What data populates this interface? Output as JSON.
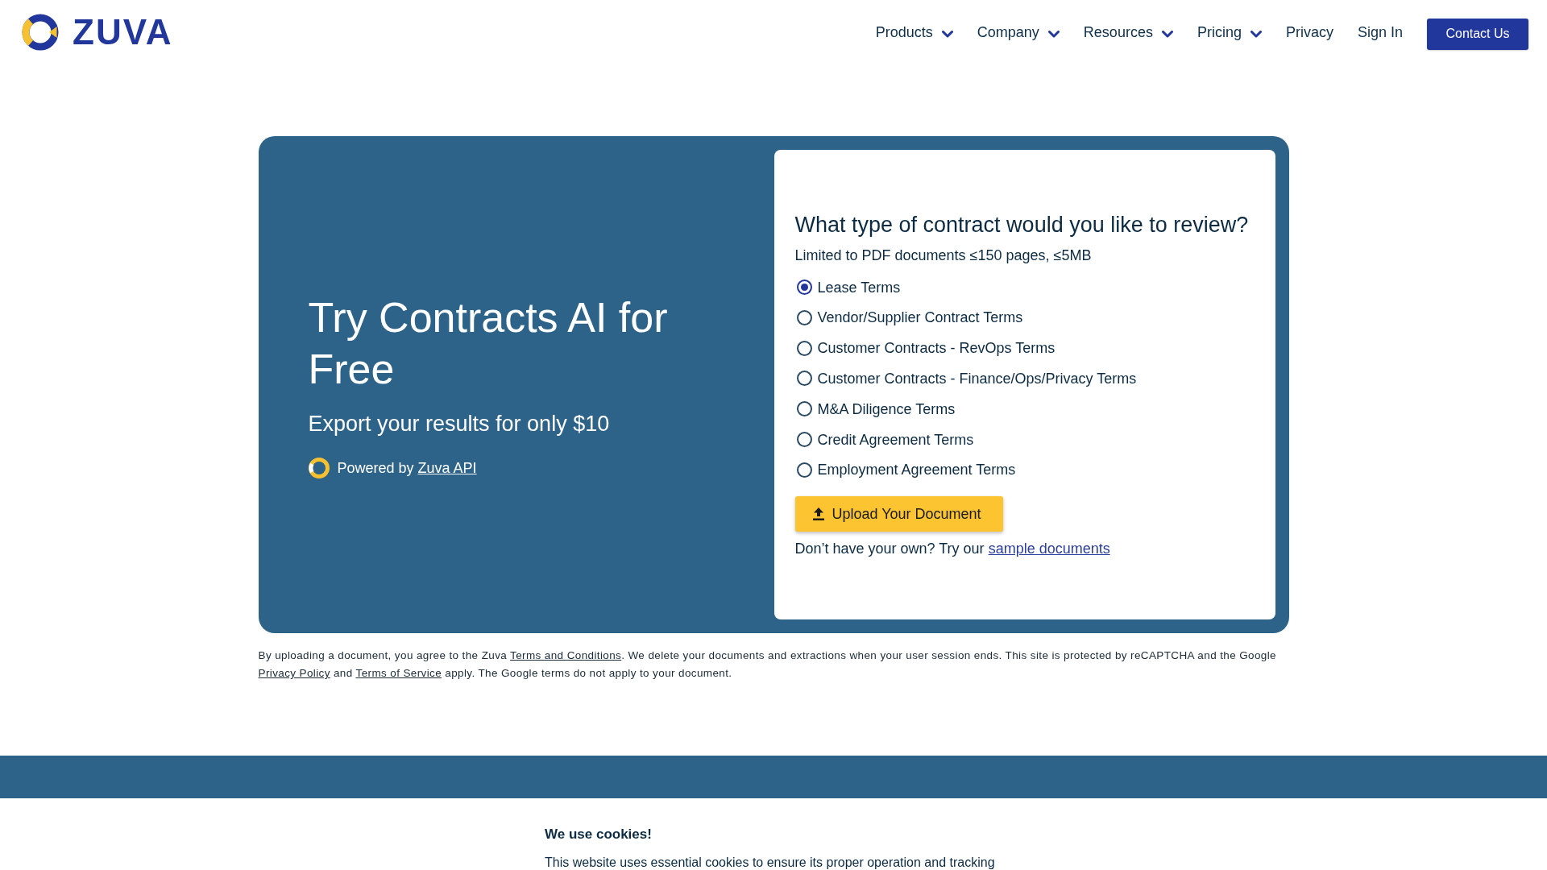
{
  "header": {
    "logo": {
      "text": "ZUVA"
    },
    "nav": [
      {
        "label": "Products",
        "has_menu": true
      },
      {
        "label": "Company",
        "has_menu": true
      },
      {
        "label": "Resources",
        "has_menu": true
      },
      {
        "label": "Pricing",
        "has_menu": true
      },
      {
        "label": "Privacy",
        "has_menu": false
      },
      {
        "label": "Sign In",
        "has_menu": false
      }
    ],
    "contact_button": "Contact Us"
  },
  "hero": {
    "title": "Try Contracts AI for Free",
    "subtitle": "Export your results for only $10",
    "powered_by": {
      "text": "Powered by ",
      "link": "Zuva API"
    }
  },
  "form": {
    "question": "What type of contract would you like to review?",
    "limits": "Limited to PDF documents ≤150 pages, ≤5MB",
    "options": [
      {
        "label": "Lease Terms",
        "selected": true
      },
      {
        "label": "Vendor/Supplier Contract Terms",
        "selected": false
      },
      {
        "label": "Customer Contracts - RevOps Terms",
        "selected": false
      },
      {
        "label": "Customer Contracts - Finance/Ops/Privacy Terms",
        "selected": false
      },
      {
        "label": "M&A Diligence Terms",
        "selected": false
      },
      {
        "label": "Credit Agreement Terms",
        "selected": false
      },
      {
        "label": "Employment Agreement Terms",
        "selected": false
      }
    ],
    "upload_button": "Upload Your Document",
    "sample_prompt": {
      "text": "Don’t have your own? Try our ",
      "link": "sample documents"
    }
  },
  "legal_notice": [
    {
      "kind": "text",
      "text": "By uploading a document, you agree to the Zuva "
    },
    {
      "kind": "link",
      "text": "Terms and Conditions"
    },
    {
      "kind": "text",
      "text": ". We delete your documents and extractions when your user session ends. This site is protected by reCAPTCHA and the Google "
    },
    {
      "kind": "link",
      "text": "Privacy Policy"
    },
    {
      "kind": "text",
      "text": " and "
    },
    {
      "kind": "link",
      "text": "Terms of Service"
    },
    {
      "kind": "text",
      "text": " apply. The Google terms do not apply to your document."
    }
  ],
  "cookie_banner": {
    "title": "We use cookies!",
    "text": "This website uses essential cookies to ensure its proper operation and tracking"
  }
}
